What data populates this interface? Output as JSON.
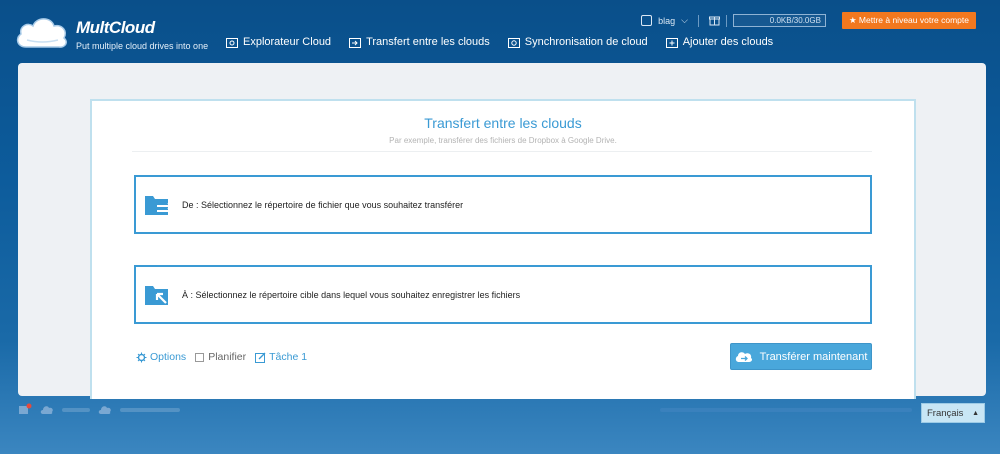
{
  "brand": {
    "name": "MultCloud",
    "tagline": "Put multiple cloud drives into one"
  },
  "nav": [
    {
      "label": "Explorateur Cloud",
      "icon": "folder-cloud-icon"
    },
    {
      "label": "Transfert entre les clouds",
      "icon": "transfer-arrow-icon"
    },
    {
      "label": "Synchronisation de cloud",
      "icon": "sync-icon"
    },
    {
      "label": "Ajouter des clouds",
      "icon": "add-cloud-icon"
    }
  ],
  "header": {
    "username": "blag",
    "quota": "0.0KB/30.0GB",
    "upgrade_label": "★ Mettre à niveau votre compte"
  },
  "card": {
    "title": "Transfert entre les clouds",
    "subtitle": "Par exemple, transférer des fichiers de Dropbox à Google Drive.",
    "from_label": "De : Sélectionnez le répertoire de fichier que vous souhaitez transférer",
    "to_label": "À : Sélectionnez le répertoire cible dans lequel vous souhaitez enregistrer les fichiers",
    "options_label": "Options",
    "schedule_label": "Planifier",
    "task_label": "Tâche 1",
    "transfer_button": "Transférer maintenant"
  },
  "footer": {
    "language": "Français"
  },
  "colors": {
    "accent": "#3a9ad4",
    "upgrade": "#f2781f",
    "background": "#0d5c9c"
  }
}
